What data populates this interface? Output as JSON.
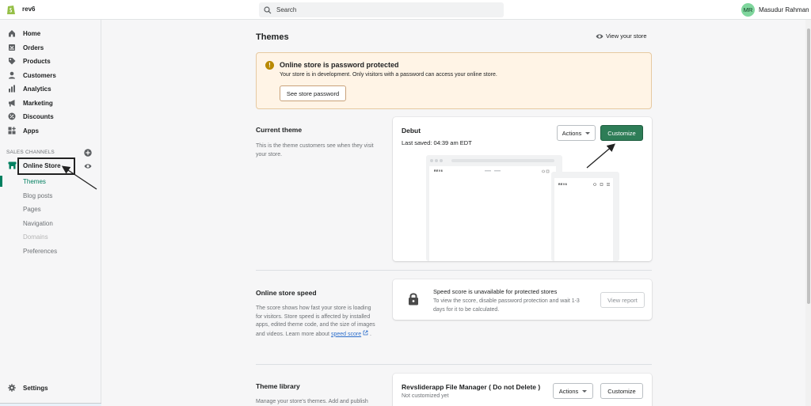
{
  "topbar": {
    "store_name": "rev6",
    "search_placeholder": "Search",
    "avatar_initials": "MR",
    "user_name": "Masudur Rahman"
  },
  "sidebar": {
    "items": [
      {
        "label": "Home",
        "icon": "home-icon"
      },
      {
        "label": "Orders",
        "icon": "orders-icon"
      },
      {
        "label": "Products",
        "icon": "tag-icon"
      },
      {
        "label": "Customers",
        "icon": "person-icon"
      },
      {
        "label": "Analytics",
        "icon": "bar-chart-icon"
      },
      {
        "label": "Marketing",
        "icon": "megaphone-icon"
      },
      {
        "label": "Discounts",
        "icon": "discount-icon"
      },
      {
        "label": "Apps",
        "icon": "apps-icon"
      }
    ],
    "sales_channels_title": "SALES CHANNELS",
    "online_store_label": "Online Store",
    "sub_items": [
      "Themes",
      "Blog posts",
      "Pages",
      "Navigation",
      "Domains",
      "Preferences"
    ],
    "settings_label": "Settings"
  },
  "main": {
    "title": "Themes",
    "view_store": "View your store",
    "banner": {
      "title": "Online store is password protected",
      "text": "Your store is in development. Only visitors with a password can access your online store.",
      "button": "See store password",
      "warning_mark": "!"
    },
    "current_theme": {
      "title": "Current theme",
      "description": "This is the theme customers see when they visit your store.",
      "theme_name": "Debut",
      "last_saved": "Last saved: 04:39 am EDT",
      "actions_label": "Actions",
      "customize_label": "Customize",
      "preview_logo": "REV6"
    },
    "speed": {
      "title": "Online store speed",
      "description": "The score shows how fast your store is loading for visitors. Store speed is affected by installed apps, edited theme code, and the size of images and videos. Learn more about",
      "link": "speed score",
      "period": ".",
      "card_title": "Speed score is unavailable for protected stores",
      "card_text": "To view the score, disable password protection and wait 1-3 days for it to be calculated.",
      "button": "View report"
    },
    "library": {
      "title": "Theme library",
      "description": "Manage your store's themes. Add and publish",
      "theme_name": "Revsliderapp File Manager ( Do not Delete )",
      "status": "Not customized yet",
      "actions_label": "Actions",
      "customize_label": "Customize"
    }
  },
  "colors": {
    "accent": "#008060",
    "primary_button": "#2e7d57",
    "banner_bg": "#fff4e6",
    "warning": "#b98900"
  }
}
